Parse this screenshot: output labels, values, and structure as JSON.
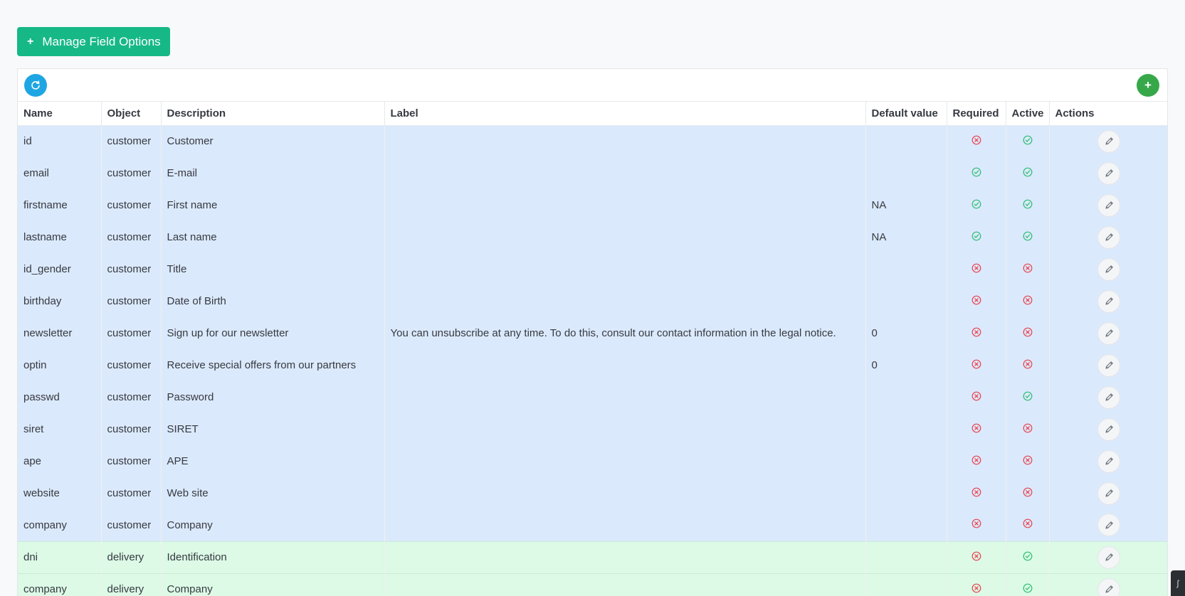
{
  "manage_button": {
    "label": "Manage Field Options"
  },
  "columns": [
    "Name",
    "Object",
    "Description",
    "Label",
    "Default value",
    "Required",
    "Active",
    "Actions"
  ],
  "rows": [
    {
      "name": "id",
      "object": "customer",
      "description": "Customer",
      "label": "",
      "default": "",
      "required": false,
      "active": true
    },
    {
      "name": "email",
      "object": "customer",
      "description": "E-mail",
      "label": "",
      "default": "",
      "required": true,
      "active": true
    },
    {
      "name": "firstname",
      "object": "customer",
      "description": "First name",
      "label": "",
      "default": "NA",
      "required": true,
      "active": true
    },
    {
      "name": "lastname",
      "object": "customer",
      "description": "Last name",
      "label": "",
      "default": "NA",
      "required": true,
      "active": true
    },
    {
      "name": "id_gender",
      "object": "customer",
      "description": "Title",
      "label": "",
      "default": "",
      "required": false,
      "active": false
    },
    {
      "name": "birthday",
      "object": "customer",
      "description": "Date of Birth",
      "label": "",
      "default": "",
      "required": false,
      "active": false
    },
    {
      "name": "newsletter",
      "object": "customer",
      "description": "Sign up for our newsletter",
      "label": "You can unsubscribe at any time. To do this, consult our contact information in the legal notice.",
      "default": "0",
      "required": false,
      "active": false
    },
    {
      "name": "optin",
      "object": "customer",
      "description": "Receive special offers from our partners",
      "label": "",
      "default": "0",
      "required": false,
      "active": false
    },
    {
      "name": "passwd",
      "object": "customer",
      "description": "Password",
      "label": "",
      "default": "",
      "required": false,
      "active": true
    },
    {
      "name": "siret",
      "object": "customer",
      "description": "SIRET",
      "label": "",
      "default": "",
      "required": false,
      "active": false
    },
    {
      "name": "ape",
      "object": "customer",
      "description": "APE",
      "label": "",
      "default": "",
      "required": false,
      "active": false
    },
    {
      "name": "website",
      "object": "customer",
      "description": "Web site",
      "label": "",
      "default": "",
      "required": false,
      "active": false
    },
    {
      "name": "company",
      "object": "customer",
      "description": "Company",
      "label": "",
      "default": "",
      "required": false,
      "active": false
    },
    {
      "name": "dni",
      "object": "delivery",
      "description": "Identification",
      "label": "",
      "default": "",
      "required": false,
      "active": true
    },
    {
      "name": "company",
      "object": "delivery",
      "description": "Company",
      "label": "",
      "default": "",
      "required": false,
      "active": true
    }
  ],
  "icons": {
    "refresh": "refresh-icon",
    "add": "plus-icon",
    "edit": "pencil-icon",
    "yes": "check-circle-icon",
    "no": "x-circle-icon"
  },
  "colors": {
    "primary_button": "#16b886",
    "refresh_button": "#1ea6e2",
    "add_button": "#37a849",
    "customer_row": "#dbe9fc",
    "delivery_row": "#dcfae6",
    "yes": "#2fbf71",
    "no": "#e8444f"
  }
}
